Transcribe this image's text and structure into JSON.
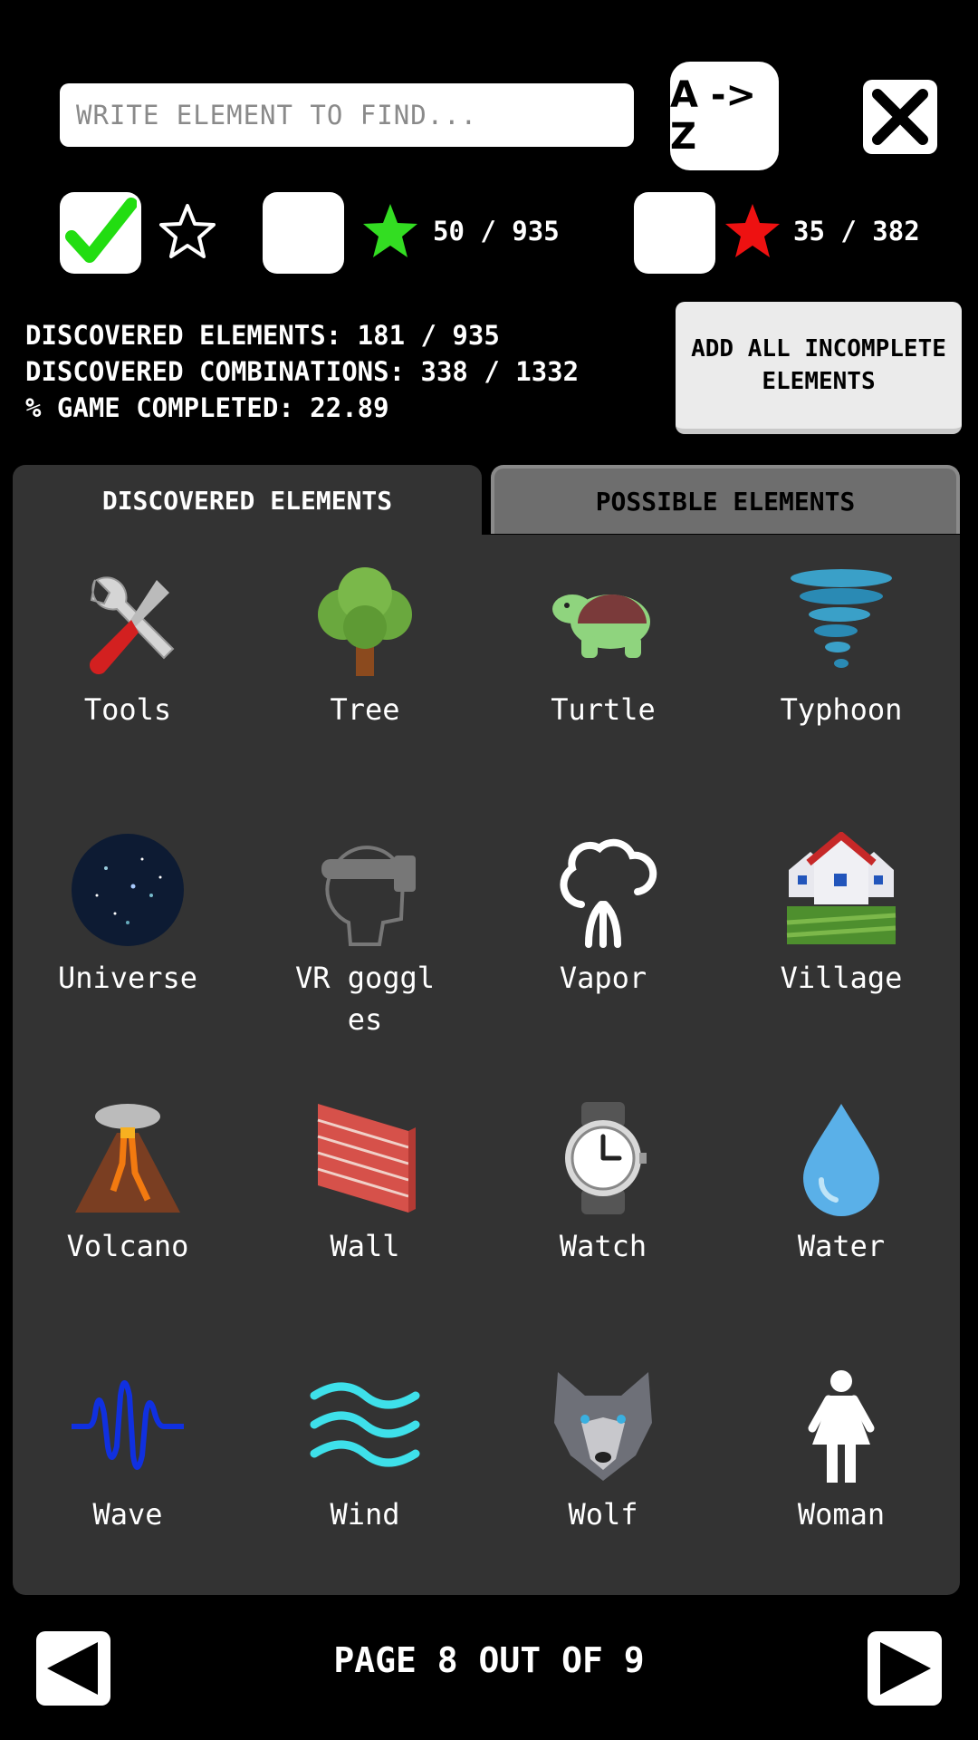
{
  "search": {
    "placeholder": "WRITE ELEMENT TO FIND...",
    "value": ""
  },
  "sort_button": {
    "label": "A -> Z"
  },
  "filters": {
    "all_checked": true,
    "green_count": "50 / 935",
    "red_count": "35 / 382"
  },
  "stats": {
    "discovered_elements": "DISCOVERED ELEMENTS: 181 / 935",
    "discovered_combinations": "DISCOVERED COMBINATIONS: 338 / 1332",
    "game_completed": "% GAME COMPLETED: 22.89"
  },
  "add_button": {
    "label": "ADD ALL INCOMPLETE ELEMENTS"
  },
  "tabs": [
    {
      "label": "DISCOVERED ELEMENTS",
      "active": true
    },
    {
      "label": "POSSIBLE ELEMENTS",
      "active": false
    }
  ],
  "elements": [
    {
      "label": "Tools",
      "icon": "tools-icon"
    },
    {
      "label": "Tree",
      "icon": "tree-icon"
    },
    {
      "label": "Turtle",
      "icon": "turtle-icon"
    },
    {
      "label": "Typhoon",
      "icon": "typhoon-icon"
    },
    {
      "label": "Universe",
      "icon": "universe-icon"
    },
    {
      "label": "VR goggles",
      "icon": "vr-goggles-icon"
    },
    {
      "label": "Vapor",
      "icon": "vapor-icon"
    },
    {
      "label": "Village",
      "icon": "village-icon"
    },
    {
      "label": "Volcano",
      "icon": "volcano-icon"
    },
    {
      "label": "Wall",
      "icon": "wall-icon"
    },
    {
      "label": "Watch",
      "icon": "watch-icon"
    },
    {
      "label": "Water",
      "icon": "water-icon"
    },
    {
      "label": "Wave",
      "icon": "wave-icon"
    },
    {
      "label": "Wind",
      "icon": "wind-icon"
    },
    {
      "label": "Wolf",
      "icon": "wolf-icon"
    },
    {
      "label": "Woman",
      "icon": "woman-icon"
    }
  ],
  "pagination": {
    "text": "PAGE 8 OUT OF 9"
  },
  "colors": {
    "background": "#000000",
    "panel": "#333333",
    "green_star": "#33dd22",
    "red_star": "#ee1111",
    "check": "#22dd11"
  }
}
